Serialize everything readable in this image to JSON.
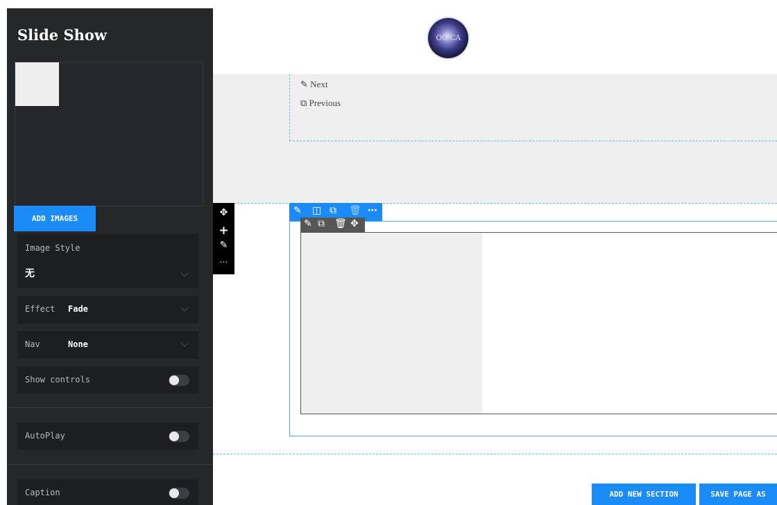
{
  "sidebar": {
    "title": "Slide Show",
    "add_images": "ADD IMAGES",
    "image_style": {
      "label": "Image Style",
      "value": "无"
    },
    "effect": {
      "label": "Effect",
      "value": "Fade"
    },
    "nav": {
      "label": "Nav",
      "value": "None"
    },
    "show_controls": {
      "label": "Show controls",
      "on": false
    },
    "autoplay": {
      "label": "AutoPlay",
      "on": false
    },
    "caption": {
      "label": "Caption",
      "on": false
    }
  },
  "canvas": {
    "logo_text": "OO CA",
    "menu_links": [
      {
        "icon": "pencil-icon",
        "label": "Next"
      },
      {
        "icon": "copy-icon",
        "label": "Previous"
      }
    ]
  },
  "footer": {
    "add_section": "ADD NEW SECTION",
    "save_page": "SAVE PAGE AS"
  },
  "colors": {
    "accent": "#1b8cf7",
    "sidebar_bg": "#262729",
    "guide_dashed": "#5cc3d6"
  }
}
